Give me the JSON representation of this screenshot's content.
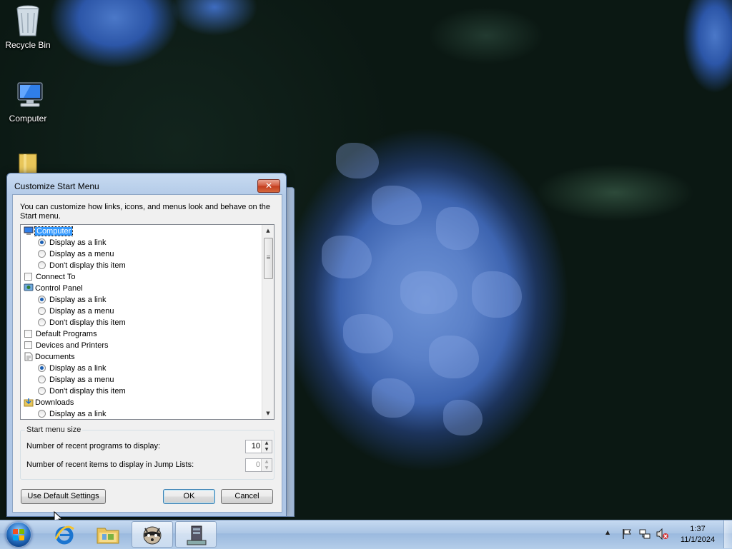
{
  "desktop": {
    "icons": [
      {
        "label": "Recycle Bin",
        "icon": "recycle-bin-icon"
      },
      {
        "label": "Computer",
        "icon": "computer-icon"
      },
      {
        "label": "",
        "icon": "folder-icon"
      }
    ]
  },
  "dialog": {
    "title": "Customize Start Menu",
    "close_label": "✕",
    "intro": "You can customize how links, icons, and menus look and behave on the Start menu.",
    "items": [
      {
        "type": "header",
        "icon": "computer-icon",
        "label": "Computer",
        "selected": true
      },
      {
        "type": "radio",
        "label": "Display as a link",
        "checked": true
      },
      {
        "type": "radio",
        "label": "Display as a menu",
        "checked": false
      },
      {
        "type": "radio",
        "label": "Don't display this item",
        "checked": false
      },
      {
        "type": "checkbox",
        "label": "Connect To",
        "checked": false
      },
      {
        "type": "header",
        "icon": "control-panel-icon",
        "label": "Control Panel"
      },
      {
        "type": "radio",
        "label": "Display as a link",
        "checked": true
      },
      {
        "type": "radio",
        "label": "Display as a menu",
        "checked": false
      },
      {
        "type": "radio",
        "label": "Don't display this item",
        "checked": false
      },
      {
        "type": "checkbox",
        "label": "Default Programs",
        "checked": false
      },
      {
        "type": "checkbox",
        "label": "Devices and Printers",
        "checked": false
      },
      {
        "type": "header",
        "icon": "documents-icon",
        "label": "Documents"
      },
      {
        "type": "radio",
        "label": "Display as a link",
        "checked": true
      },
      {
        "type": "radio",
        "label": "Display as a menu",
        "checked": false
      },
      {
        "type": "radio",
        "label": "Don't display this item",
        "checked": false
      },
      {
        "type": "header",
        "icon": "downloads-icon",
        "label": "Downloads"
      },
      {
        "type": "radio",
        "label": "Display as a link",
        "checked": false
      }
    ],
    "size_group": {
      "label": "Start menu size",
      "recent_programs_label": "Number of recent programs to display:",
      "recent_programs_value": "10",
      "jump_list_label": "Number of recent items to display in Jump Lists:",
      "jump_list_value": "0"
    },
    "buttons": {
      "defaults": "Use Default Settings",
      "ok": "OK",
      "cancel": "Cancel"
    }
  },
  "taskbar": {
    "items": [
      {
        "name": "internet-explorer",
        "icon": "internet-explorer-icon"
      },
      {
        "name": "file-explorer",
        "icon": "folder-icon"
      },
      {
        "name": "raccoon-app",
        "icon": "raccoon-icon"
      },
      {
        "name": "server-app",
        "icon": "server-icon"
      }
    ],
    "clock": {
      "time": "1:37",
      "date": "11/1/2024"
    }
  },
  "colors": {
    "selection": "#3399ff",
    "radio_dot": "#1a5fb4",
    "dialog_frame": "#aec6e6"
  }
}
